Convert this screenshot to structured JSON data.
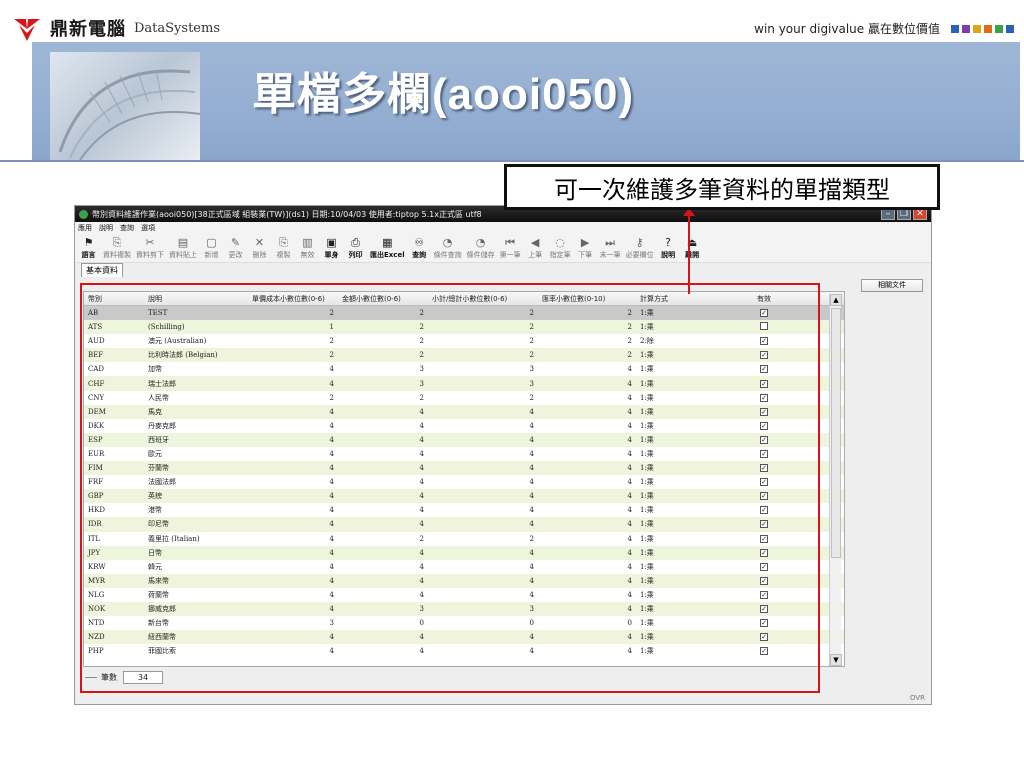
{
  "header": {
    "brand_cn": "鼎新電腦",
    "brand_en": "DataSystems",
    "slogan": "win your digivalue 贏在數位價值",
    "slogan_squares": [
      "#2b62b8",
      "#7a3fa8",
      "#e0a419",
      "#e06b1a",
      "#3aa24a",
      "#2b62b8"
    ]
  },
  "title": "單檔多欄(aooi050)",
  "callout": "可一次維護多筆資料的單擋類型",
  "window": {
    "title": "幣別資料維護作業(aooi050)[38正式區域 組裝業(TW)](ds1) 日期:10/04/03 使用者:tiptop 5.1x正式區 utf8",
    "menus": [
      "應用",
      "說明",
      "查詢",
      "選項"
    ],
    "toolbar": [
      {
        "icon": "flag-icon",
        "glyph": "⚑",
        "label": "語言",
        "on": true
      },
      {
        "icon": "copy-icon",
        "glyph": "⎘",
        "label": "資料複製",
        "on": false
      },
      {
        "icon": "scissors-icon",
        "glyph": "✂",
        "label": "資料剪下",
        "on": false
      },
      {
        "icon": "paste-icon",
        "glyph": "▤",
        "label": "資料貼上",
        "on": false
      },
      {
        "icon": "new-icon",
        "glyph": "▢",
        "label": "新增",
        "on": false
      },
      {
        "icon": "edit-icon",
        "glyph": "✎",
        "label": "更改",
        "on": false
      },
      {
        "icon": "delete-icon",
        "glyph": "✕",
        "label": "刪除",
        "on": false
      },
      {
        "icon": "duplicate-icon",
        "glyph": "⎘",
        "label": "複製",
        "on": false
      },
      {
        "icon": "void-icon",
        "glyph": "▥",
        "label": "無效",
        "on": false
      },
      {
        "icon": "form-icon",
        "glyph": "▣",
        "label": "單身",
        "on": true
      },
      {
        "icon": "print-icon",
        "glyph": "⎙",
        "label": "列印",
        "on": true
      },
      {
        "icon": "excel-icon",
        "glyph": "▦",
        "label": "匯出Excel",
        "on": true
      },
      {
        "icon": "binoculars-icon",
        "glyph": "♾",
        "label": "查詢",
        "on": true
      },
      {
        "icon": "condition-query-icon",
        "glyph": "◔",
        "label": "條件查詢",
        "on": false
      },
      {
        "icon": "condition-save-icon",
        "glyph": "◔",
        "label": "條件儲存",
        "on": false
      },
      {
        "icon": "first-icon",
        "glyph": "⏮",
        "label": "第一筆",
        "on": false
      },
      {
        "icon": "prev-icon",
        "glyph": "◀",
        "label": "上筆",
        "on": false
      },
      {
        "icon": "goto-icon",
        "glyph": "◌",
        "label": "指定筆",
        "on": false
      },
      {
        "icon": "next-icon",
        "glyph": "▶",
        "label": "下筆",
        "on": false
      },
      {
        "icon": "last-icon",
        "glyph": "⏭",
        "label": "末一筆",
        "on": false
      },
      {
        "icon": "key-icon",
        "glyph": "⚷",
        "label": "必要欄位",
        "on": false
      },
      {
        "icon": "help-icon",
        "glyph": "?",
        "label": "說明",
        "on": true
      },
      {
        "icon": "exit-icon",
        "glyph": "⏏",
        "label": "離開",
        "on": true
      }
    ],
    "tab": "基本資料",
    "related_button": "相關文件",
    "columns": [
      "幣別",
      "說明",
      "單價成本小數位數(0-6)",
      "金額小數位數(0-6)",
      "小計/總計小數位數(0-6)",
      "匯率小數位數(0-10)",
      "計算方式",
      "有效"
    ],
    "rows": [
      [
        "AB",
        "TEST",
        "2",
        "2",
        "2",
        "2 1:乘",
        true
      ],
      [
        "ATS",
        "(Schilling)",
        "1",
        "2",
        "2",
        "2 1:乘",
        false
      ],
      [
        "AUD",
        "澳元 (Australian)",
        "2",
        "2",
        "2",
        "2 2:除",
        true
      ],
      [
        "BEF",
        "比利時法郎 (Belgian)",
        "2",
        "2",
        "2",
        "2 1:乘",
        true
      ],
      [
        "CAD",
        "加幣",
        "4",
        "3",
        "3",
        "4 1:乘",
        true
      ],
      [
        "CHF",
        "瑞士法郎",
        "4",
        "3",
        "3",
        "4 1:乘",
        true
      ],
      [
        "CNY",
        "人民幣",
        "2",
        "2",
        "2",
        "4 1:乘",
        true
      ],
      [
        "DEM",
        "馬克",
        "4",
        "4",
        "4",
        "4 1:乘",
        true
      ],
      [
        "DKK",
        "丹麥克郎",
        "4",
        "4",
        "4",
        "4 1:乘",
        true
      ],
      [
        "ESP",
        "西班牙",
        "4",
        "4",
        "4",
        "4 1:乘",
        true
      ],
      [
        "EUR",
        "歐元",
        "4",
        "4",
        "4",
        "4 1:乘",
        true
      ],
      [
        "FIM",
        "芬蘭幣",
        "4",
        "4",
        "4",
        "4 1:乘",
        true
      ],
      [
        "FRF",
        "法國法郎",
        "4",
        "4",
        "4",
        "4 1:乘",
        true
      ],
      [
        "GBP",
        "英鎊",
        "4",
        "4",
        "4",
        "4 1:乘",
        true
      ],
      [
        "HKD",
        "港幣",
        "4",
        "4",
        "4",
        "4 1:乘",
        true
      ],
      [
        "IDR",
        "印尼幣",
        "4",
        "4",
        "4",
        "4 1:乘",
        true
      ],
      [
        "ITL",
        "義里拉 (Italian)",
        "4",
        "2",
        "2",
        "4 1:乘",
        true
      ],
      [
        "JPY",
        "日幣",
        "4",
        "4",
        "4",
        "4 1:乘",
        true
      ],
      [
        "KRW",
        "韓元",
        "4",
        "4",
        "4",
        "4 1:乘",
        true
      ],
      [
        "MYR",
        "馬來幣",
        "4",
        "4",
        "4",
        "4 1:乘",
        true
      ],
      [
        "NLG",
        "荷蘭幣",
        "4",
        "4",
        "4",
        "4 1:乘",
        true
      ],
      [
        "NOK",
        "挪威克郎",
        "4",
        "3",
        "3",
        "4 1:乘",
        true
      ],
      [
        "NTD",
        "新台幣",
        "3",
        "0",
        "0",
        "0 1:乘",
        true
      ],
      [
        "NZD",
        "紐西蘭幣",
        "4",
        "4",
        "4",
        "4 1:乘",
        true
      ],
      [
        "PHP",
        "菲國比索",
        "4",
        "4",
        "4",
        "4 1:乘",
        true
      ]
    ],
    "status_label": "筆數",
    "record_count": "34",
    "ovr": "OVR"
  },
  "colors": {
    "accent_red": "#d7141a",
    "banner_blue": "#94aed2",
    "row_alt": "#eef5dc"
  }
}
